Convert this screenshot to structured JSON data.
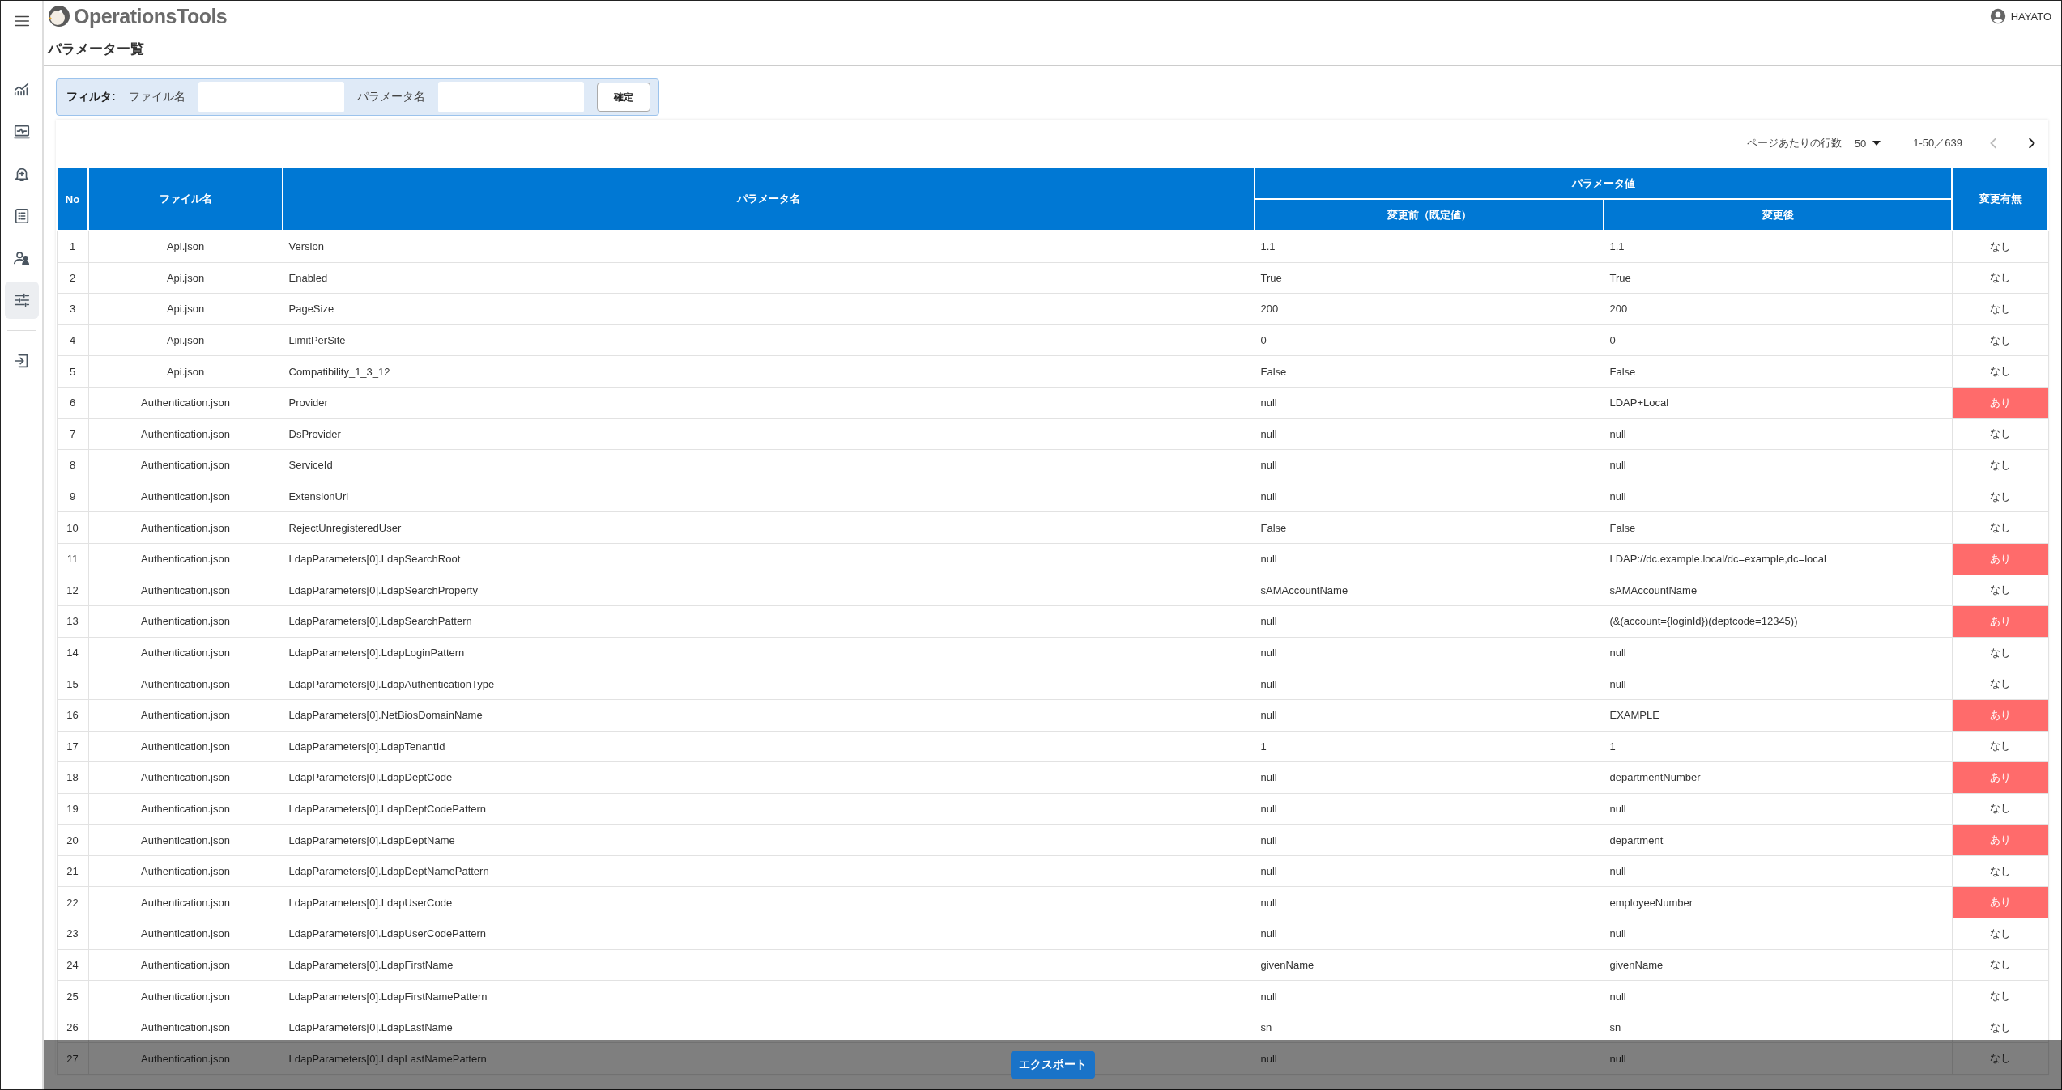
{
  "header": {
    "logo": "OperationsTools",
    "user": "HAYATO"
  },
  "sidebar": {
    "items": [
      {
        "selected": false
      },
      {
        "selected": false
      },
      {
        "selected": false
      },
      {
        "selected": false
      },
      {
        "selected": false
      },
      {
        "selected": true
      }
    ]
  },
  "page_title": "パラメーター覧",
  "filter": {
    "label": "フィルタ:",
    "fields": [
      {
        "label": "ファイル名"
      },
      {
        "label": "パラメータ名"
      }
    ],
    "button": "確定"
  },
  "pager": {
    "rows_label": "ページあたりの行数",
    "rows_per_page": "50",
    "range": "1-50／639",
    "prev_disabled": true,
    "next_disabled": false
  },
  "table": {
    "columns": {
      "no": "No",
      "file": "ファイル名",
      "param": "パラメータ名",
      "value_group": "パラメータ値",
      "before": "変更前（既定値）",
      "after": "変更後",
      "changed": "変更有無"
    },
    "rows": [
      {
        "no": "1",
        "file": "Api.json",
        "param": "Version",
        "before": "1.1",
        "after": "1.1",
        "status": "なし",
        "changed": false
      },
      {
        "no": "2",
        "file": "Api.json",
        "param": "Enabled",
        "before": "True",
        "after": "True",
        "status": "なし",
        "changed": false
      },
      {
        "no": "3",
        "file": "Api.json",
        "param": "PageSize",
        "before": "200",
        "after": "200",
        "status": "なし",
        "changed": false
      },
      {
        "no": "4",
        "file": "Api.json",
        "param": "LimitPerSite",
        "before": "0",
        "after": "0",
        "status": "なし",
        "changed": false
      },
      {
        "no": "5",
        "file": "Api.json",
        "param": "Compatibility_1_3_12",
        "before": "False",
        "after": "False",
        "status": "なし",
        "changed": false
      },
      {
        "no": "6",
        "file": "Authentication.json",
        "param": "Provider",
        "before": "null",
        "after": "LDAP+Local",
        "status": "あり",
        "changed": true
      },
      {
        "no": "7",
        "file": "Authentication.json",
        "param": "DsProvider",
        "before": "null",
        "after": "null",
        "status": "なし",
        "changed": false
      },
      {
        "no": "8",
        "file": "Authentication.json",
        "param": "ServiceId",
        "before": "null",
        "after": "null",
        "status": "なし",
        "changed": false
      },
      {
        "no": "9",
        "file": "Authentication.json",
        "param": "ExtensionUrl",
        "before": "null",
        "after": "null",
        "status": "なし",
        "changed": false
      },
      {
        "no": "10",
        "file": "Authentication.json",
        "param": "RejectUnregisteredUser",
        "before": "False",
        "after": "False",
        "status": "なし",
        "changed": false
      },
      {
        "no": "11",
        "file": "Authentication.json",
        "param": "LdapParameters[0].LdapSearchRoot",
        "before": "null",
        "after": "LDAP://dc.example.local/dc=example,dc=local",
        "status": "あり",
        "changed": true
      },
      {
        "no": "12",
        "file": "Authentication.json",
        "param": "LdapParameters[0].LdapSearchProperty",
        "before": "sAMAccountName",
        "after": "sAMAccountName",
        "status": "なし",
        "changed": false
      },
      {
        "no": "13",
        "file": "Authentication.json",
        "param": "LdapParameters[0].LdapSearchPattern",
        "before": "null",
        "after": "(&(account={loginId})(deptcode=12345))",
        "status": "あり",
        "changed": true
      },
      {
        "no": "14",
        "file": "Authentication.json",
        "param": "LdapParameters[0].LdapLoginPattern",
        "before": "null",
        "after": "null",
        "status": "なし",
        "changed": false
      },
      {
        "no": "15",
        "file": "Authentication.json",
        "param": "LdapParameters[0].LdapAuthenticationType",
        "before": "null",
        "after": "null",
        "status": "なし",
        "changed": false
      },
      {
        "no": "16",
        "file": "Authentication.json",
        "param": "LdapParameters[0].NetBiosDomainName",
        "before": "null",
        "after": "EXAMPLE",
        "status": "あり",
        "changed": true
      },
      {
        "no": "17",
        "file": "Authentication.json",
        "param": "LdapParameters[0].LdapTenantId",
        "before": "1",
        "after": "1",
        "status": "なし",
        "changed": false
      },
      {
        "no": "18",
        "file": "Authentication.json",
        "param": "LdapParameters[0].LdapDeptCode",
        "before": "null",
        "after": "departmentNumber",
        "status": "あり",
        "changed": true
      },
      {
        "no": "19",
        "file": "Authentication.json",
        "param": "LdapParameters[0].LdapDeptCodePattern",
        "before": "null",
        "after": "null",
        "status": "なし",
        "changed": false
      },
      {
        "no": "20",
        "file": "Authentication.json",
        "param": "LdapParameters[0].LdapDeptName",
        "before": "null",
        "after": "department",
        "status": "あり",
        "changed": true
      },
      {
        "no": "21",
        "file": "Authentication.json",
        "param": "LdapParameters[0].LdapDeptNamePattern",
        "before": "null",
        "after": "null",
        "status": "なし",
        "changed": false
      },
      {
        "no": "22",
        "file": "Authentication.json",
        "param": "LdapParameters[0].LdapUserCode",
        "before": "null",
        "after": "employeeNumber",
        "status": "あり",
        "changed": true
      },
      {
        "no": "23",
        "file": "Authentication.json",
        "param": "LdapParameters[0].LdapUserCodePattern",
        "before": "null",
        "after": "null",
        "status": "なし",
        "changed": false
      },
      {
        "no": "24",
        "file": "Authentication.json",
        "param": "LdapParameters[0].LdapFirstName",
        "before": "givenName",
        "after": "givenName",
        "status": "なし",
        "changed": false
      },
      {
        "no": "25",
        "file": "Authentication.json",
        "param": "LdapParameters[0].LdapFirstNamePattern",
        "before": "null",
        "after": "null",
        "status": "なし",
        "changed": false
      },
      {
        "no": "26",
        "file": "Authentication.json",
        "param": "LdapParameters[0].LdapLastName",
        "before": "sn",
        "after": "sn",
        "status": "なし",
        "changed": false
      },
      {
        "no": "27",
        "file": "Authentication.json",
        "param": "LdapParameters[0].LdapLastNamePattern",
        "before": "null",
        "after": "null",
        "status": "なし",
        "changed": false
      }
    ]
  },
  "export_button": "エクスポート"
}
